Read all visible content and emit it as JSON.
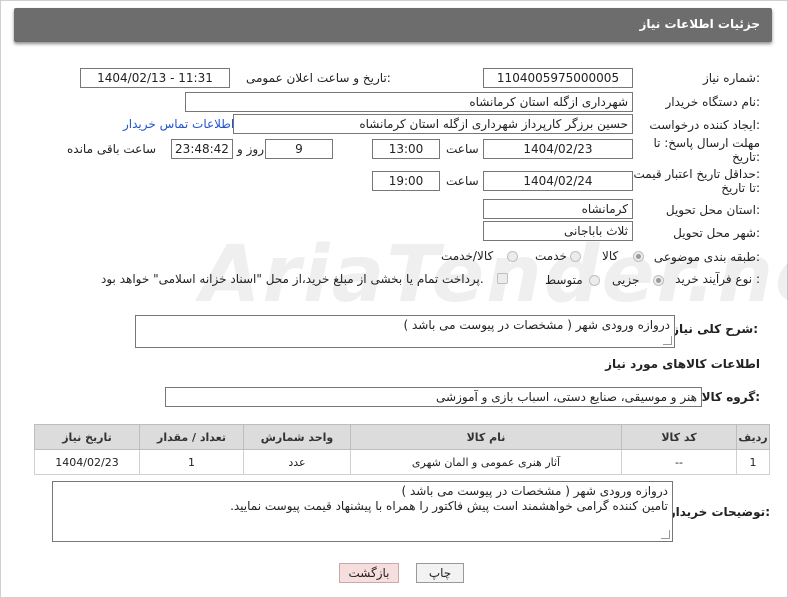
{
  "title": "جزئیات اطلاعات نیاز",
  "need_number_label": "شماره نیاز:",
  "need_number": "1104005975000005",
  "announce_label": "تاریخ و ساعت اعلان عمومی:",
  "announce_value": "1404/02/13 - 11:31",
  "buyer_org_label": "نام دستگاه خریدار:",
  "buyer_org": "شهرداری ازگله استان کرمانشاه",
  "creator_label": "ایجاد کننده درخواست:",
  "creator": "حسین برزگر کارپرداز شهرداری ازگله استان کرمانشاه",
  "contact_link": "اطلاعات تماس خریدار",
  "deadline_label_1": "مهلت ارسال پاسخ: تا",
  "deadline_label_2": "تاریخ:",
  "deadline_date": "1404/02/23",
  "time_label": "ساعت",
  "deadline_time": "13:00",
  "days_value": "9",
  "days_label": "روز و",
  "remaining_value": "23:48:42",
  "remaining_label": "ساعت باقی مانده",
  "validity_label_1": "حداقل تاریخ اعتبار قیمت:",
  "validity_label_2": "تا تاریخ:",
  "validity_date": "1404/02/24",
  "validity_time": "19:00",
  "province_label": "استان محل تحویل:",
  "province": "کرمانشاه",
  "city_label": "شهر محل تحویل:",
  "city": "ثلاث باباجانی",
  "category_label": "طبقه بندی موضوعی:",
  "category_options": [
    "کالا",
    "خدمت",
    "کالا/خدمت"
  ],
  "process_label": "نوع فرآیند خرید :",
  "process_options": [
    "جزیی",
    "متوسط"
  ],
  "payment_note": "پرداخت تمام یا بخشی از مبلغ خرید،از محل \"اسناد خزانه اسلامی\" خواهد بود.",
  "general_desc_label": "شرح کلی نیاز:",
  "general_desc": "دروازه ورودی شهر ( مشخصات در پیوست می باشد )",
  "goods_info_title": "اطلاعات کالاهای مورد نیاز",
  "goods_group_label": "گروه کالا:",
  "goods_group": "هنر و موسیقی، صنایع دستی، اسباب بازی و آموزشی",
  "table": {
    "headers": [
      "ردیف",
      "کد کالا",
      "نام کالا",
      "واحد شمارش",
      "تعداد / مقدار",
      "تاریخ نیاز"
    ],
    "rows": [
      [
        "1",
        "--",
        "آثار هنری عمومی و المان شهری",
        "عدد",
        "1",
        "1404/02/23"
      ]
    ]
  },
  "buyer_notes_label": "توضیحات خریدار:",
  "buyer_notes_line1": "دروازه ورودی شهر ( مشخصات در پیوست می باشد )",
  "buyer_notes_line2": "تامین کننده گرامی خواهشمند است پیش فاکتور را همراه با پیشنهاد قیمت پیوست نمایید.",
  "print_button": "چاپ",
  "back_button": "بازگشت",
  "watermark": "AriaTender.net"
}
